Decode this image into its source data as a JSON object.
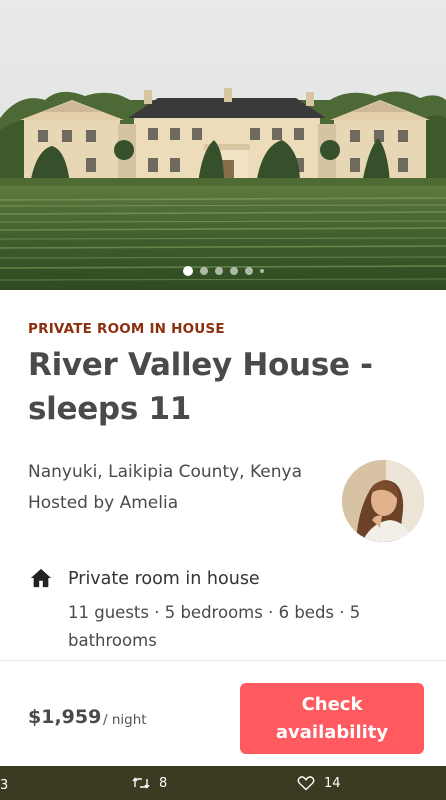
{
  "carousel": {
    "total_dots": 6,
    "active_index": 0
  },
  "listing": {
    "room_type": "PRIVATE ROOM IN HOUSE",
    "title": "River Valley House - sleeps 11",
    "location": "Nanyuki, Laikipia County, Kenya",
    "host_line": "Hosted by Amelia",
    "room_label": "Private room in house",
    "room_specs": "11 guests · 5 bedrooms · 6 beds · 5 bathrooms"
  },
  "booking": {
    "price": "$1,959",
    "per_night": "/ night",
    "check_label": "Check availability"
  },
  "tweet_bar": {
    "left_count": "3",
    "retweet_count": "8",
    "like_count": "14"
  },
  "colors": {
    "accent": "#ff5a5f",
    "room_type": "#8c2f0c",
    "tweet_bar": "#3d3a22"
  },
  "icons": [
    "house-icon",
    "retweet-icon",
    "heart-icon"
  ]
}
